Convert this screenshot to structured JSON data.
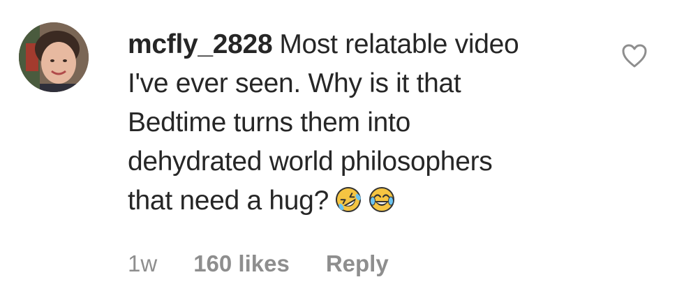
{
  "comment": {
    "username": "mcfly_2828",
    "text_lines": [
      "Most relatable video",
      "I've ever seen. Why is it that",
      "Bedtime turns them into",
      "dehydrated world philosophers",
      "that need a hug?"
    ],
    "emojis": [
      "rolling-on-floor-laughing-icon",
      "tears-of-joy-icon"
    ],
    "avatar": "profile-photo-avatar",
    "like_icon": "heart-outline-icon",
    "timestamp": "1w",
    "likes": "160 likes",
    "reply_label": "Reply"
  },
  "colors": {
    "text": "#262626",
    "meta": "#8e8e8e",
    "heart_stroke": "#8e8e8e",
    "emoji_face": "#f5c542"
  }
}
